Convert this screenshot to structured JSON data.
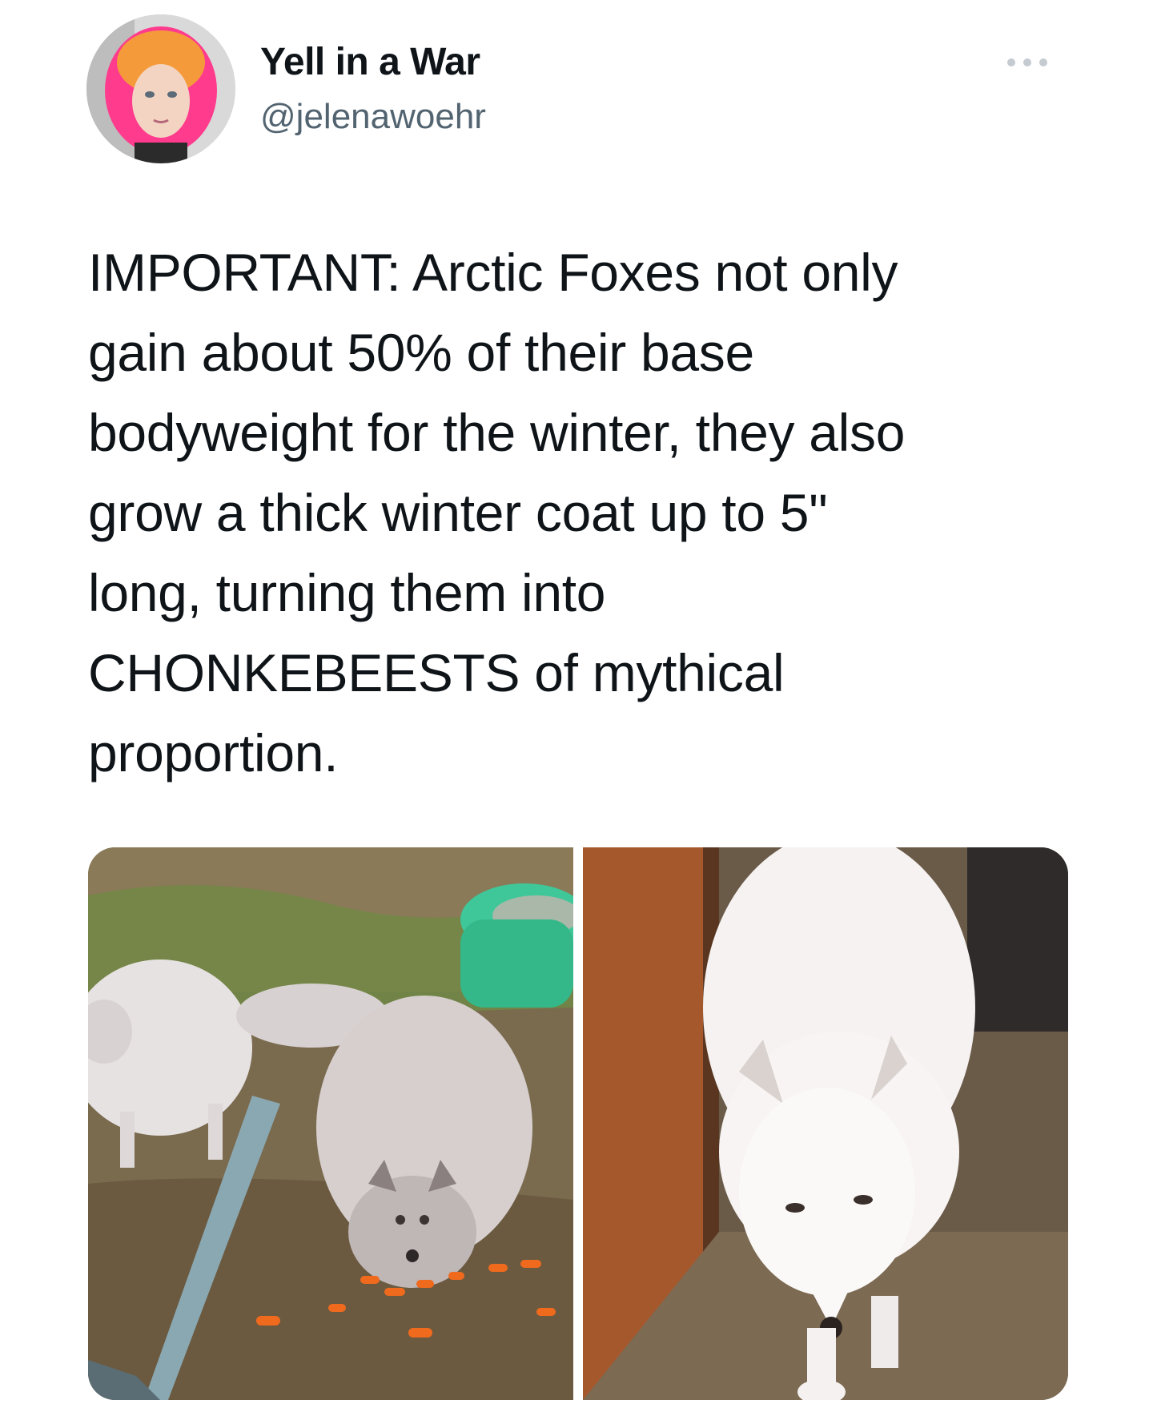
{
  "author": {
    "name": "Yell in a War",
    "handle": "@jelenawoehr",
    "avatar_icon": "profile-photo"
  },
  "menu": {
    "more_icon": "more-horizontal-icon",
    "color": "#8b98a5"
  },
  "tweet": {
    "text": "IMPORTANT: Arctic Foxes not only\ngain about 50% of their base\nbodyweight for the winter, they also\ngrow a thick winter coat up to 5\"\nlong, turning them into\nCHONKEBEESTS of mythical\nproportion."
  },
  "media": {
    "photos": [
      {
        "icon": "photo-fat-arctic-foxes-eating-carrots"
      },
      {
        "icon": "photo-white-arctic-fox"
      }
    ]
  }
}
